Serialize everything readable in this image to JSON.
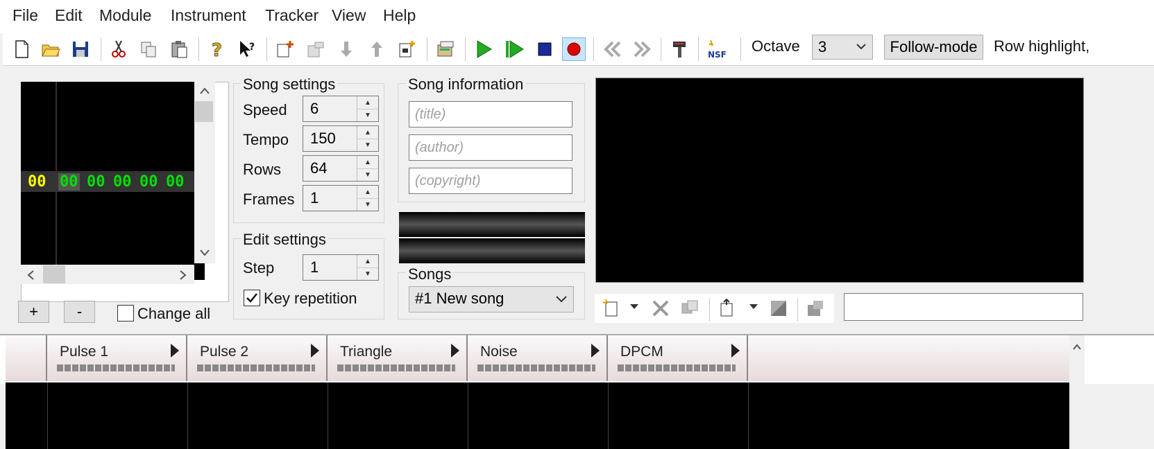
{
  "menubar": [
    "File",
    "Edit",
    "Module",
    "Instrument",
    "Tracker",
    "View",
    "Help"
  ],
  "toolbar": {
    "icons": [
      "new-file-icon",
      "open-folder-icon",
      "save-icon",
      "cut-icon",
      "copy-icon",
      "paste-icon",
      "help-icon",
      "context-help-icon",
      "add-frame-icon",
      "remove-frame-icon",
      "move-frame-down-icon",
      "move-frame-up-icon",
      "duplicate-frame-icon",
      "module-properties-icon",
      "play-icon",
      "play-loop-icon",
      "stop-icon",
      "record-icon",
      "previous-song-icon",
      "next-song-icon",
      "settings-icon",
      "nsf-export-icon"
    ],
    "octave_label": "Octave",
    "octave_value": "3",
    "follow_mode": "Follow-mode",
    "row_highlight": "Row highlight,"
  },
  "frames": {
    "row_index": "00",
    "cells": [
      "00",
      "00",
      "00",
      "00",
      "00"
    ],
    "add_label": "+",
    "remove_label": "-",
    "change_all_label": "Change all"
  },
  "song_settings": {
    "title": "Song settings",
    "speed_label": "Speed",
    "speed": "6",
    "tempo_label": "Tempo",
    "tempo": "150",
    "rows_label": "Rows",
    "rows": "64",
    "frames_label": "Frames",
    "frames": "1"
  },
  "edit_settings": {
    "title": "Edit settings",
    "step_label": "Step",
    "step": "1",
    "key_repetition_label": "Key repetition",
    "key_repetition": true
  },
  "song_info": {
    "title": "Song information",
    "title_placeholder": "(title)",
    "author_placeholder": "(author)",
    "copyright_placeholder": "(copyright)"
  },
  "songs": {
    "title": "Songs",
    "selected": "#1 New song"
  },
  "channels": [
    "Pulse 1",
    "Pulse 2",
    "Triangle",
    "Noise",
    "DPCM"
  ],
  "colors": {
    "frame_index": "#ffff00",
    "frame_cell": "#00e000",
    "accent_play": "#22aa22",
    "record": "#dd0000"
  }
}
